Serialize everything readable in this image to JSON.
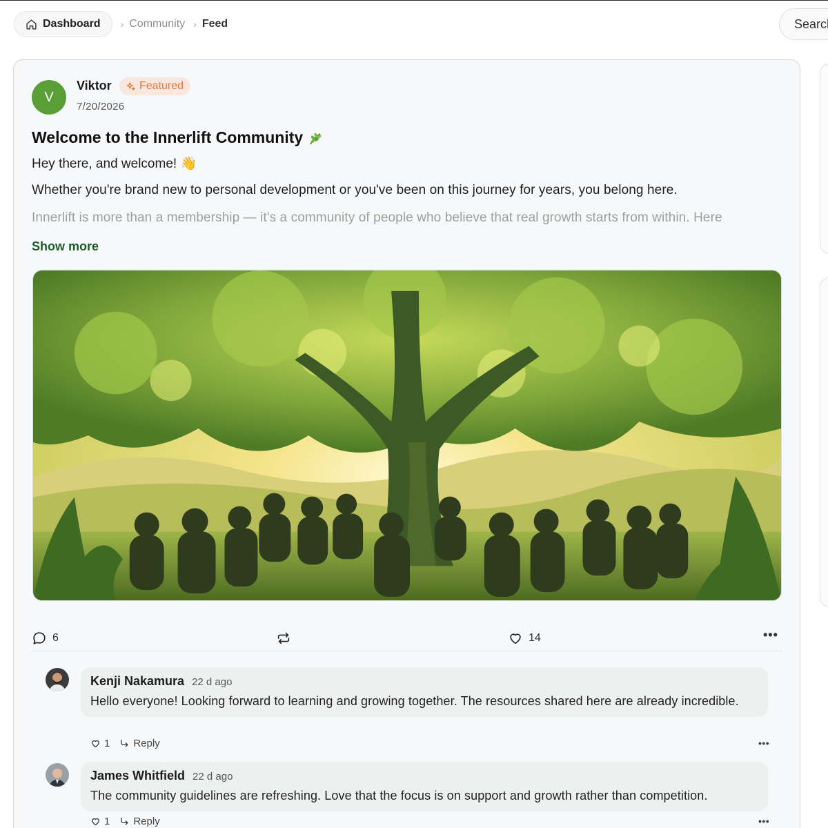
{
  "breadcrumb": {
    "home_label": "Dashboard",
    "items": [
      "Community",
      "Feed"
    ]
  },
  "search": {
    "label": "Search"
  },
  "post": {
    "author_initial": "V",
    "author": "Viktor",
    "badge": "Featured",
    "date": "7/20/2026",
    "title": "Welcome to the Innerlift Community",
    "paragraphs": [
      "Hey there, and welcome! 👋",
      "Whether you're brand new to personal development or you've been on this journey for years, you belong here.",
      "Innerlift is more than a membership — it's a community of people who believe that real growth starts from within. Here"
    ],
    "show_more": "Show more",
    "image_alt": "Illustration of people sitting in a circle beneath a large glowing tree",
    "comment_count": "6",
    "like_count": "14",
    "more": "•••"
  },
  "comments": [
    {
      "name": "Kenji Nakamura",
      "time": "22 d ago",
      "text": "Hello everyone! Looking forward to learning and growing together. The resources shared here are already incredible.",
      "likes": "1",
      "reply": "Reply"
    },
    {
      "name": "James Whitfield",
      "time": "22 d ago",
      "text": "The community guidelines are refreshing. Love that the focus is on support and growth rather than competition.",
      "likes": "1",
      "reply": "Reply"
    }
  ],
  "colors": {
    "avatar": "#5a9e36",
    "badge_text": "#e0793c",
    "badge_bg": "#f9e6dc",
    "show_more": "#1d5b2b"
  }
}
